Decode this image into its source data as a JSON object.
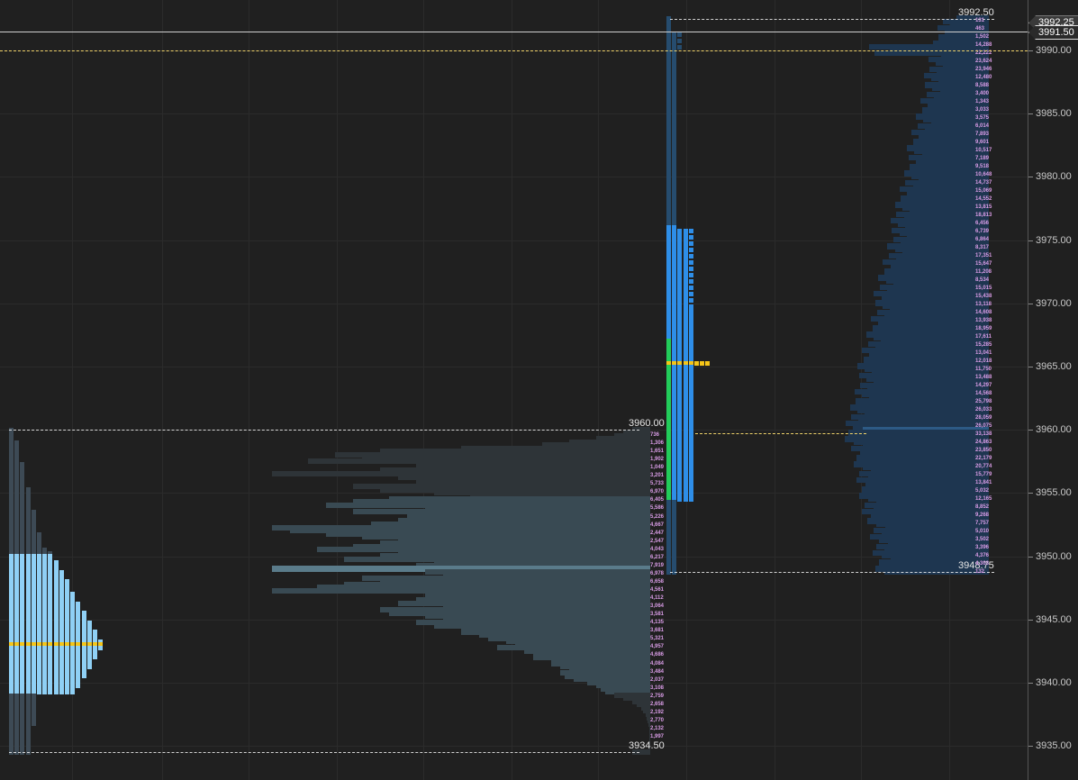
{
  "price_axis": {
    "ticks": [
      "3990.00",
      "3985.00",
      "3980.00",
      "3975.00",
      "3970.00",
      "3965.00",
      "3960.00",
      "3955.00",
      "3950.00",
      "3945.00",
      "3940.00",
      "3935.00"
    ],
    "tag_high": "3992.25",
    "tag_last": "3991.50"
  },
  "profiles": {
    "left": {
      "high_label": "3960.00",
      "low_label": "3934.50",
      "poc": 3943.0,
      "high": 3960.0,
      "low": 3934.5
    },
    "right": {
      "high_label": "3992.50",
      "low_label": "3948.75",
      "poc": 3965.25,
      "high": 3992.5,
      "low": 3948.75
    }
  },
  "left_volume_labels": [
    "736",
    "1,306",
    "1,651",
    "1,902",
    "1,049",
    "3,201",
    "5,733",
    "6,970",
    "6,405",
    "5,586",
    "5,226",
    "4,667",
    "2,447",
    "2,547",
    "4,043",
    "6,217",
    "7,919",
    "6,978",
    "6,658",
    "4,561",
    "4,112",
    "3,064",
    "3,581",
    "4,135",
    "3,681",
    "5,321",
    "4,957",
    "4,686",
    "4,084",
    "3,484",
    "2,037",
    "3,108",
    "2,759",
    "2,658",
    "2,192",
    "2,770",
    "2,132",
    "1,997"
  ],
  "right_volume_labels": [
    "131",
    "463",
    "1,502",
    "14,288",
    "22,222",
    "23,624",
    "23,946",
    "12,480",
    "8,588",
    "3,400",
    "1,343",
    "3,033",
    "3,575",
    "6,014",
    "7,893",
    "9,601",
    "10,517",
    "7,189",
    "9,518",
    "10,648",
    "14,737",
    "15,069",
    "14,552",
    "13,815",
    "18,813",
    "6,456",
    "6,739",
    "6,864",
    "8,317",
    "17,351",
    "15,647",
    "11,208",
    "8,534",
    "15,015",
    "15,438",
    "13,118",
    "14,608",
    "13,938",
    "18,959",
    "17,611",
    "15,285",
    "13,041",
    "12,018",
    "11,750",
    "13,488",
    "14,297",
    "14,568",
    "25,798",
    "26,033",
    "28,059",
    "26,075",
    "33,138",
    "24,863",
    "23,850",
    "22,179",
    "20,774",
    "15,779",
    "13,841",
    "5,032",
    "12,165",
    "8,852",
    "9,268",
    "7,757",
    "5,010",
    "3,502",
    "3,396",
    "4,376",
    "4,303",
    "132"
  ],
  "colors": {
    "background": "#202020",
    "left_tpo": "#8fd0f5",
    "left_tpo_dark": "#3d4a55",
    "right_tpo": "#2e8ee8",
    "right_tpo_dark": "#264c6e",
    "initial_balance": "#22cc5a",
    "poc": "#f5c518",
    "label": "#d99ce6",
    "volume_gray": "#3a4a52",
    "volume_blue": "#1f3d5e"
  }
}
